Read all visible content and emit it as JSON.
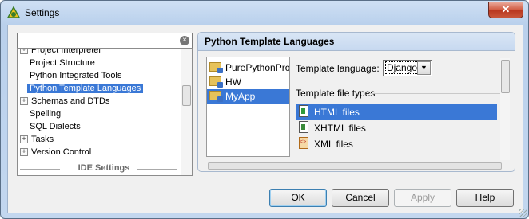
{
  "window": {
    "title": "Settings",
    "close_label": "✕"
  },
  "search": {
    "placeholder": "",
    "value": "",
    "clear_icon": "clear-search-icon"
  },
  "tree": {
    "items": [
      {
        "label": "Project Interpreter",
        "expandable": true
      },
      {
        "label": "Project Structure",
        "expandable": false
      },
      {
        "label": "Python Integrated Tools",
        "expandable": false
      },
      {
        "label": "Python Template Languages",
        "expandable": false,
        "selected": true
      },
      {
        "label": "Schemas and DTDs",
        "expandable": true
      },
      {
        "label": "Spelling",
        "expandable": false
      },
      {
        "label": "SQL Dialects",
        "expandable": false
      },
      {
        "label": "Tasks",
        "expandable": true
      },
      {
        "label": "Version Control",
        "expandable": true
      }
    ],
    "section_label": "IDE Settings"
  },
  "panel": {
    "title": "Python Template Languages",
    "projects": [
      {
        "label": "PurePythonProject"
      },
      {
        "label": "HW"
      },
      {
        "label": "MyApp",
        "selected": true
      }
    ],
    "template_language_label": "Template language:",
    "template_language_value": "Django",
    "file_types_label": "Template file types",
    "file_types": [
      {
        "label": "HTML files",
        "icon": "html-file-icon",
        "selected": true
      },
      {
        "label": "XHTML files",
        "icon": "xhtml-file-icon"
      },
      {
        "label": "XML files",
        "icon": "xml-file-icon"
      }
    ]
  },
  "buttons": {
    "ok": "OK",
    "cancel": "Cancel",
    "apply": "Apply",
    "help": "Help"
  },
  "colors": {
    "selection": "#3a78d6",
    "header_bg": "#c7d9f0",
    "frame": "#b9d0ec"
  }
}
